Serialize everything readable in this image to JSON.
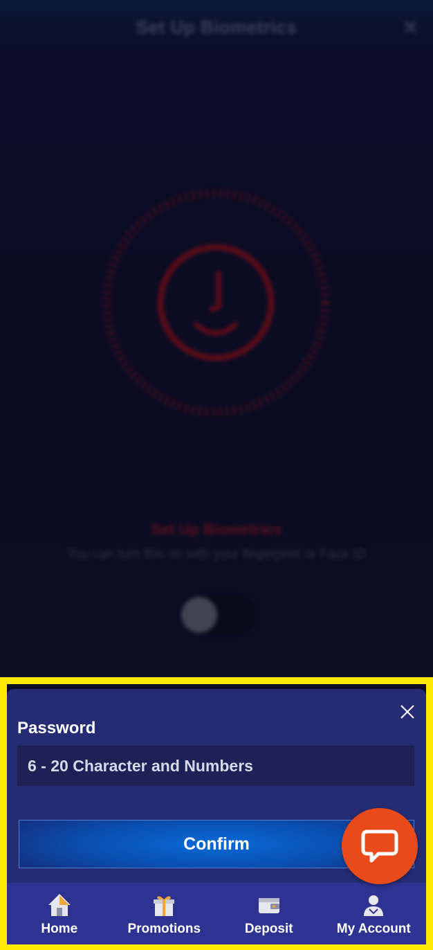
{
  "background_screen": {
    "title": "Set Up Biometrics",
    "heading": "Set Up Biometrics",
    "description": "You can turn this on with your fingerprint or Face ID",
    "toggle_state": "off",
    "icon": "face-id-icon",
    "accent_color": "#5e0f1c"
  },
  "password_sheet": {
    "label": "Password",
    "input_placeholder": "6 - 20 Character and Numbers",
    "input_value": "",
    "confirm_label": "Confirm",
    "close_icon": "close-icon"
  },
  "bottom_nav": {
    "items": [
      {
        "label": "Home",
        "icon": "home-icon"
      },
      {
        "label": "Promotions",
        "icon": "gift-icon"
      },
      {
        "label": "Deposit",
        "icon": "wallet-icon"
      },
      {
        "label": "My Account",
        "icon": "user-icon"
      }
    ]
  },
  "chat": {
    "icon": "chat-bubble-icon",
    "color": "#e84a1a"
  },
  "colors": {
    "highlight": "#ffea00",
    "sheet": "#252c74",
    "nav": "#2e3290",
    "confirm": "#0a5fcf"
  }
}
